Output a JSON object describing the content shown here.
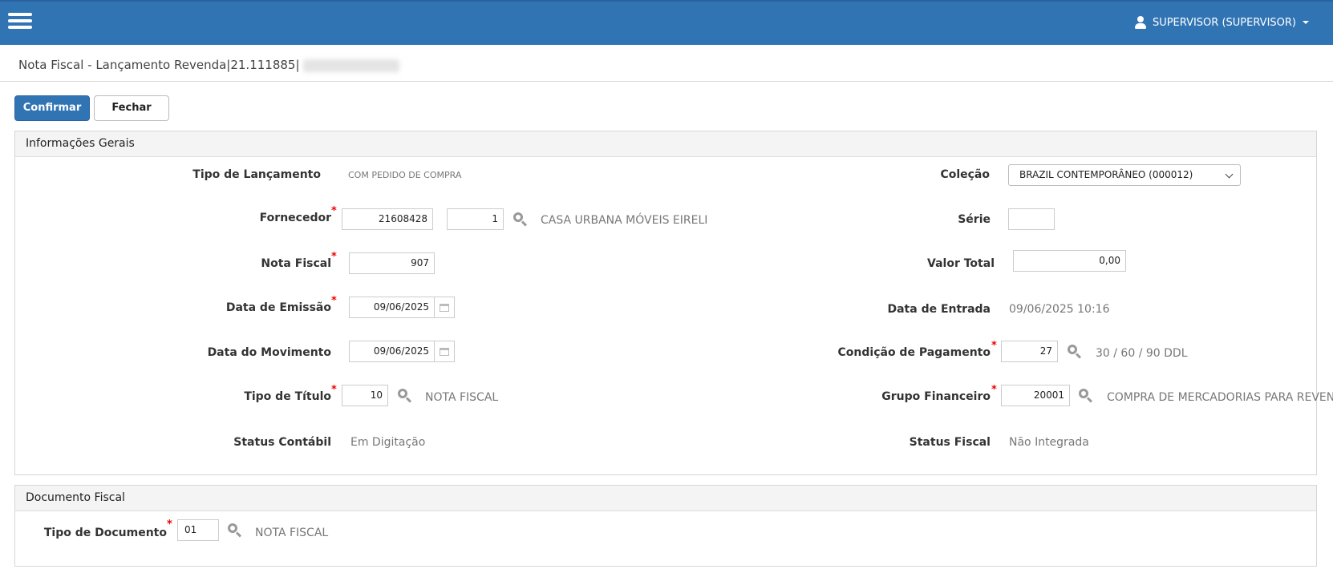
{
  "header": {
    "user_label": "SUPERVISOR (SUPERVISOR)"
  },
  "page": {
    "title": "Nota Fiscal - Lançamento Revenda|21.111885|"
  },
  "toolbar": {
    "confirm_label": "Confirmar",
    "close_label": "Fechar"
  },
  "general": {
    "title": "Informações Gerais",
    "tipo_lancamento": {
      "label": "Tipo de Lançamento",
      "value": "COM PEDIDO DE COMPRA"
    },
    "colecao": {
      "label": "Coleção",
      "value": "BRAZIL CONTEMPORÂNEO (000012)"
    },
    "fornecedor": {
      "label": "Fornecedor",
      "code": "21608428",
      "seq": "1",
      "name": "CASA URBANA MÓVEIS EIRELI"
    },
    "serie": {
      "label": "Série",
      "value": ""
    },
    "nota_fiscal": {
      "label": "Nota Fiscal",
      "value": "907"
    },
    "valor_total": {
      "label": "Valor Total",
      "value": "0,00"
    },
    "data_emissao": {
      "label": "Data de Emissão",
      "value": "09/06/2025"
    },
    "data_entrada": {
      "label": "Data de Entrada",
      "value": "09/06/2025 10:16"
    },
    "data_movimento": {
      "label": "Data do Movimento",
      "value": "09/06/2025"
    },
    "condicao_pagamento": {
      "label": "Condição de Pagamento",
      "code": "27",
      "desc": "30 / 60 / 90 DDL"
    },
    "tipo_titulo": {
      "label": "Tipo de Título",
      "code": "10",
      "desc": "NOTA FISCAL"
    },
    "grupo_financeiro": {
      "label": "Grupo Financeiro",
      "code": "20001",
      "desc": "COMPRA DE MERCADORIAS PARA REVENDA"
    },
    "status_contabil": {
      "label": "Status Contábil",
      "value": "Em Digitação"
    },
    "status_fiscal": {
      "label": "Status Fiscal",
      "value": "Não Integrada"
    }
  },
  "documento": {
    "title": "Documento Fiscal",
    "tipo_documento": {
      "label": "Tipo de Documento",
      "code": "01",
      "desc": "NOTA FISCAL"
    }
  },
  "required_mark": "*"
}
